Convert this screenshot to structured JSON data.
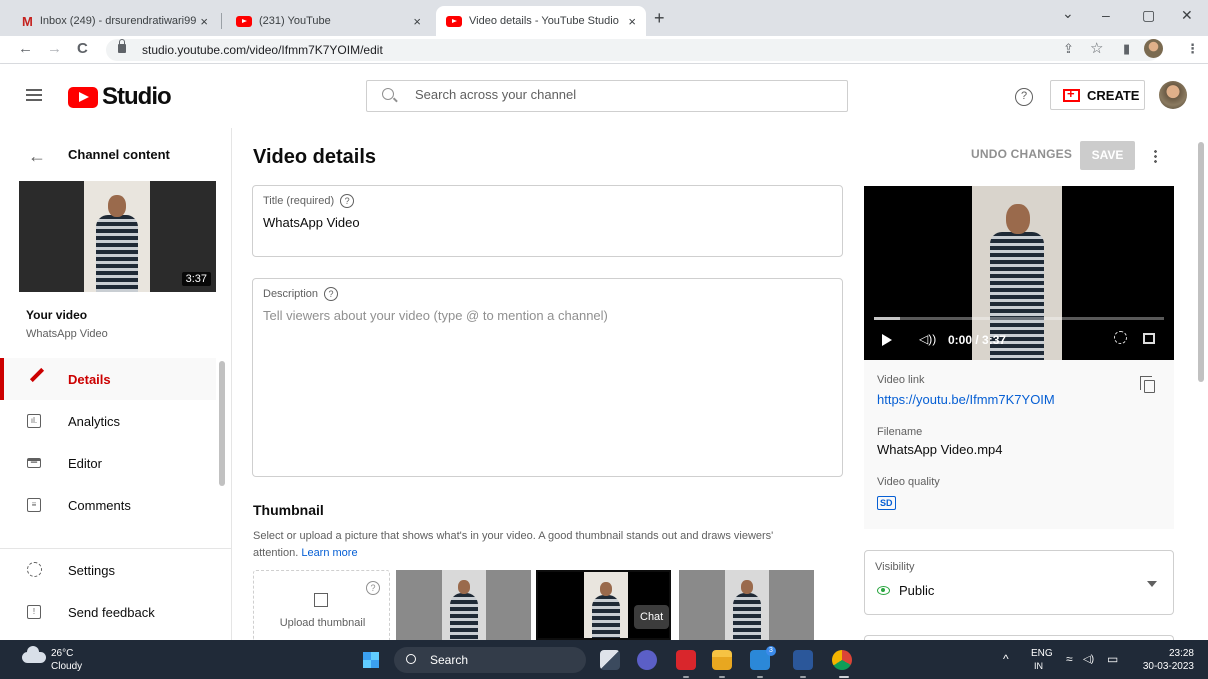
{
  "browser": {
    "tabs": [
      {
        "title": "Inbox (249) - drsurendratiwari99",
        "favicon": "gmail-icon",
        "close": "×"
      },
      {
        "title": "(231) YouTube",
        "favicon": "youtube-icon",
        "close": "×"
      },
      {
        "title": "Video details - YouTube Studio",
        "favicon": "youtube-icon",
        "close": "×",
        "active": true
      }
    ],
    "new_tab": "+",
    "url": "studio.youtube.com/video/Ifmm7K7YOIM/edit",
    "nav": {
      "back": "←",
      "forward": "→",
      "reload": "C"
    },
    "window_controls": {
      "tablist": "⌄",
      "minimize": "–",
      "restore": "▢",
      "close": "✕"
    },
    "address_icons": {
      "share": "⇪",
      "star": "☆",
      "sidepanel": "▮",
      "menu": "⋮"
    }
  },
  "header": {
    "logo_text": "Studio",
    "search_placeholder": "Search across your channel",
    "help": "?",
    "create_label": "CREATE"
  },
  "sidebar": {
    "title": "Channel content",
    "duration": "3:37",
    "your_video": "Your video",
    "video_name": "WhatsApp Video",
    "items": [
      {
        "label": "Details",
        "icon": "pencil-icon",
        "selected": true
      },
      {
        "label": "Analytics",
        "icon": "analytics-icon",
        "glyph": "ıl."
      },
      {
        "label": "Editor",
        "icon": "editor-icon",
        "glyph": "▔"
      },
      {
        "label": "Comments",
        "icon": "comments-icon",
        "glyph": "≡"
      },
      {
        "label": "Settings",
        "icon": "gear-icon"
      },
      {
        "label": "Send feedback",
        "icon": "feedback-icon",
        "glyph": "!"
      }
    ]
  },
  "main": {
    "title": "Video details",
    "undo_label": "UNDO CHANGES",
    "save_label": "SAVE",
    "title_field": {
      "label": "Title (required)",
      "help": "?",
      "value": "WhatsApp Video"
    },
    "description_field": {
      "label": "Description",
      "help": "?",
      "placeholder": "Tell viewers about your video (type @ to mention a channel)"
    },
    "thumbnail": {
      "heading": "Thumbnail",
      "description": "Select or upload a picture that shows what's in your video. A good thumbnail stands out and draws viewers' attention.",
      "learn_more": "Learn more",
      "upload_label": "Upload thumbnail",
      "upload_help": "?"
    },
    "tooltip": "Chat"
  },
  "right_panel": {
    "player_time": "0:00 / 3:37",
    "video_link_label": "Video link",
    "video_link": "https://youtu.be/Ifmm7K7YOIM",
    "filename_label": "Filename",
    "filename": "WhatsApp Video.mp4",
    "quality_label": "Video quality",
    "quality_badge": "SD",
    "visibility_label": "Visibility",
    "visibility_value": "Public"
  },
  "taskbar": {
    "temperature": "26°C",
    "weather": "Cloudy",
    "search_label": "Search",
    "lang_primary": "ENG",
    "lang_secondary": "IN",
    "time": "23:28",
    "date": "30-03-2023",
    "tray_overflow": "^",
    "wifi": "≈",
    "volume": "◁)",
    "battery": "▭",
    "teams_badge": "3"
  },
  "colors": {
    "brand_red": "#ff0000",
    "selected_red": "#cc0000",
    "link_blue": "#065fd4",
    "public_green": "#2ba640",
    "taskbar": "#202a38"
  }
}
